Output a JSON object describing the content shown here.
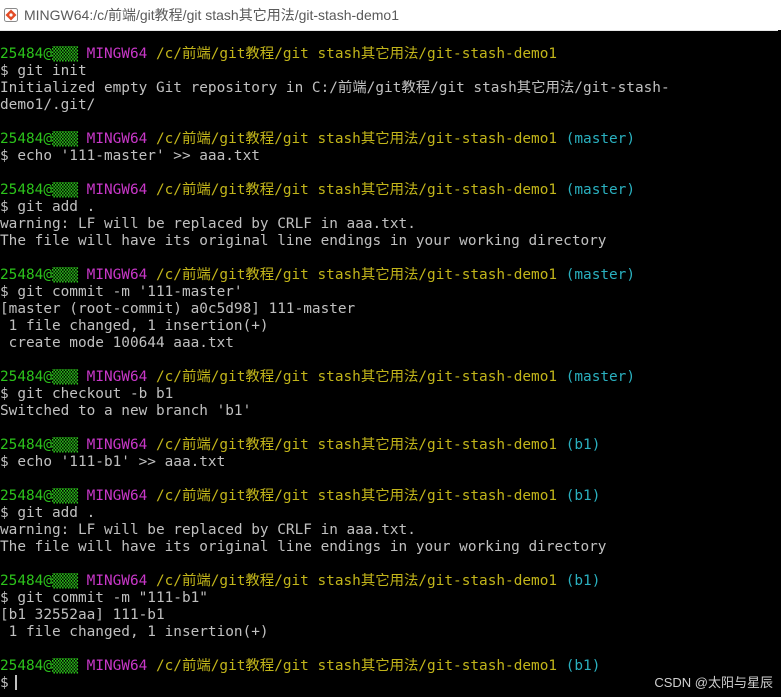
{
  "window": {
    "title": "MINGW64:/c/前端/git教程/git stash其它用法/git-stash-demo1",
    "icon": "git-bash-icon"
  },
  "prompt": {
    "user": "25484@▒▒▒",
    "env": "MINGW64",
    "path": "/c/前端/git教程/git stash其它用法/git-stash-demo1"
  },
  "blocks": [
    {
      "branch": "",
      "command": "$ git init",
      "output": [
        "Initialized empty Git repository in C:/前端/git教程/git stash其它用法/git-stash-",
        "demo1/.git/"
      ]
    },
    {
      "branch": "(master)",
      "command": "$ echo '111-master' >> aaa.txt",
      "output": []
    },
    {
      "branch": "(master)",
      "command": "$ git add .",
      "output": [
        "warning: LF will be replaced by CRLF in aaa.txt.",
        "The file will have its original line endings in your working directory"
      ]
    },
    {
      "branch": "(master)",
      "command": "$ git commit -m '111-master'",
      "output": [
        "[master (root-commit) a0c5d98] 111-master",
        " 1 file changed, 1 insertion(+)",
        " create mode 100644 aaa.txt"
      ]
    },
    {
      "branch": "(master)",
      "command": "$ git checkout -b b1",
      "output": [
        "Switched to a new branch 'b1'"
      ]
    },
    {
      "branch": "(b1)",
      "command": "$ echo '111-b1' >> aaa.txt",
      "output": []
    },
    {
      "branch": "(b1)",
      "command": "$ git add .",
      "output": [
        "warning: LF will be replaced by CRLF in aaa.txt.",
        "The file will have its original line endings in your working directory"
      ]
    },
    {
      "branch": "(b1)",
      "command": "$ git commit -m \"111-b1\"",
      "output": [
        "[b1 32552aa] 111-b1",
        " 1 file changed, 1 insertion(+)"
      ]
    }
  ],
  "final_prompt": {
    "branch": "(b1)",
    "command": "$"
  },
  "watermark": "CSDN @太阳与星辰",
  "colors": {
    "background": "#000000",
    "text": "#c0c0c0",
    "user": "#2cc31b",
    "env": "#c837c8",
    "path": "#c2b51a",
    "branch": "#2ab0bf"
  }
}
